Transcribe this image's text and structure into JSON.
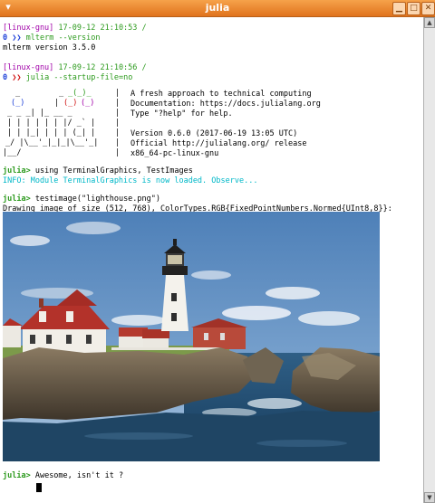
{
  "window": {
    "title": "julia"
  },
  "lines": {
    "l1_host": "[linux-gnu]",
    "l1_time": " 17-09-12 21:10:53 /",
    "l2_prompt": "0 ",
    "l2_arrows": "❯❯",
    "l2_cmd": " mlterm --version",
    "l3": "mlterm version 3.5.0",
    "l5_host": "[linux-gnu]",
    "l5_time": " 17-09-12 21:10:56 /",
    "l6_prompt": "0 ",
    "l6_arrows": "❯❯",
    "l6_cmd": " julia --startup-file=no"
  },
  "banner": {
    "text1": "A fresh approach to technical computing",
    "text2": "Documentation: https://docs.julialang.org",
    "text3": "Type \"?help\" for help.",
    "text5": "Version 0.6.0 (2017-06-19 13:05 UTC)",
    "text6": "Official http://julialang.org/ release",
    "text7": "x86_64-pc-linux-gnu"
  },
  "session": {
    "prompt": "julia>",
    "cmd1": " using TerminalGraphics, TestImages",
    "info": "INFO: Module TerminalGraphics is now loaded. Observe...",
    "cmd2": " testimage(\"lighthouse.png\")",
    "output": "Drawing image of size (512, 768), ColorTypes.RGB{FixedPointNumbers.Normed{UInt8,8}}:",
    "cmd3": " Awesome, isn't it ?"
  }
}
